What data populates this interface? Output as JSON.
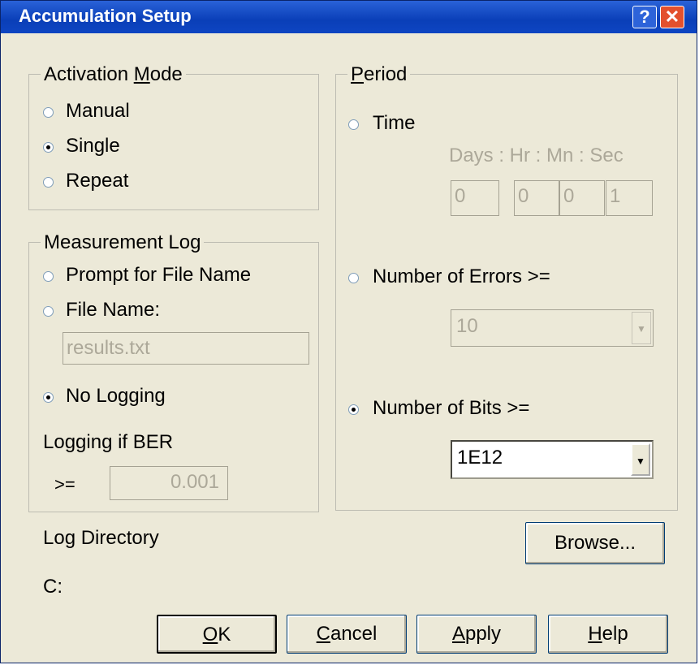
{
  "window": {
    "title": "Accumulation Setup",
    "help_icon_glyph": "?",
    "close_icon_glyph": "✕"
  },
  "activation_mode": {
    "legend_prefix": "Activation ",
    "legend_mnemonic": "M",
    "legend_suffix": "ode",
    "options": [
      {
        "label": "Manual",
        "selected": false
      },
      {
        "label": "Single",
        "selected": true
      },
      {
        "label": "Repeat",
        "selected": false
      }
    ]
  },
  "measurement_log": {
    "legend": "Measurement Log",
    "prompt_label": "Prompt for File Name",
    "file_name_label": "File Name:",
    "file_name_value": "results.txt",
    "no_logging_label": "No Logging",
    "selected": "no_logging",
    "logging_if_ber_label": "Logging if BER",
    "ber_operator": ">=",
    "ber_value": "0.001"
  },
  "period": {
    "legend_mnemonic": "P",
    "legend_suffix": "eriod",
    "time_label": "Time",
    "time_header": "Days : Hr : Mn : Sec",
    "days": "0",
    "hours": "0",
    "minutes": "0",
    "seconds": "1",
    "errors_label": "Number of Errors >=",
    "errors_value": "10",
    "bits_label": "Number of Bits >=",
    "bits_value": "1E12",
    "selected": "bits"
  },
  "log_directory": {
    "label": "Log Directory",
    "path": "C:"
  },
  "buttons": {
    "browse": "Browse...",
    "ok_mnemonic": "O",
    "ok_rest": "K",
    "cancel_mnemonic": "C",
    "cancel_rest": "ancel",
    "apply_mnemonic": "A",
    "apply_rest": "pply",
    "help_mnemonic": "H",
    "help_rest": "elp"
  },
  "colors": {
    "titlebar": "#0a3fb8",
    "dialog_bg": "#ece9d8",
    "disabled_text": "#aca899",
    "close_button": "#e3502d"
  }
}
